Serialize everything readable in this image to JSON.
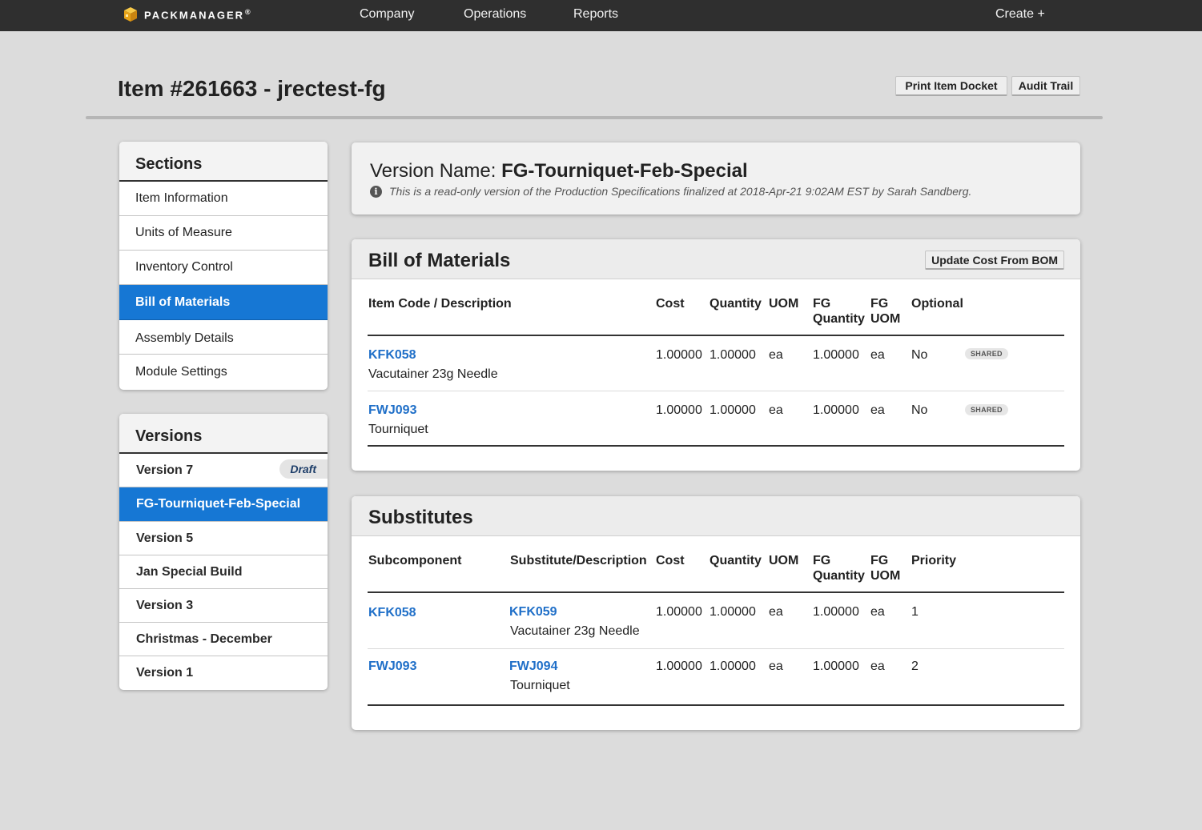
{
  "navbar": {
    "brand": "PACKMANAGER",
    "brand_mark": "®",
    "links": [
      "Company",
      "Operations",
      "Reports"
    ],
    "create": "Create +"
  },
  "page": {
    "title": "Item #261663 - jrectest-fg",
    "print_button": "Print Item Docket",
    "audit_button": "Audit Trail"
  },
  "sections": {
    "heading": "Sections",
    "items": [
      "Item Information",
      "Units of Measure",
      "Inventory Control",
      "Bill of Materials",
      "Assembly Details",
      "Module Settings"
    ],
    "active": "Bill of Materials"
  },
  "versions": {
    "heading": "Versions",
    "draft_label": "Draft",
    "items": [
      "Version 7",
      "FG-Tourniquet-Feb-Special",
      "Version 5",
      "Jan Special Build",
      "Version 3",
      "Christmas - December",
      "Version 1"
    ],
    "active": "FG-Tourniquet-Feb-Special"
  },
  "version_info": {
    "label": "Version Name:",
    "name": "FG-Tourniquet-Feb-Special",
    "note": "This is a read-only version of the Production Specifications finalized at 2018-Apr-21 9:02AM EST by Sarah Sandberg."
  },
  "bom": {
    "heading": "Bill of Materials",
    "update_button": "Update Cost From BOM",
    "columns": {
      "item": "Item Code / Description",
      "cost": "Cost",
      "quantity": "Quantity",
      "uom": "UOM",
      "fg_quantity_1": "FG",
      "fg_quantity_2": "Quantity",
      "fg_uom_1": "FG",
      "fg_uom_2": "UOM",
      "optional": "Optional"
    },
    "rows": [
      {
        "code": "KFK058",
        "description": "Vacutainer 23g Needle",
        "cost": "1.00000",
        "quantity": "1.00000",
        "uom": "ea",
        "fg_quantity": "1.00000",
        "fg_uom": "ea",
        "optional": "No",
        "badge": "SHARED"
      },
      {
        "code": "FWJ093",
        "description": "Tourniquet",
        "cost": "1.00000",
        "quantity": "1.00000",
        "uom": "ea",
        "fg_quantity": "1.00000",
        "fg_uom": "ea",
        "optional": "No",
        "badge": "SHARED"
      }
    ]
  },
  "substitutes": {
    "heading": "Substitutes",
    "columns": {
      "subcomponent": "Subcomponent",
      "substitute": "Substitute/Description",
      "cost": "Cost",
      "quantity": "Quantity",
      "uom": "UOM",
      "fg_quantity_1": "FG",
      "fg_quantity_2": "Quantity",
      "fg_uom_1": "FG",
      "fg_uom_2": "UOM",
      "priority": "Priority"
    },
    "rows": [
      {
        "subcomponent": "KFK058",
        "substitute": "KFK059",
        "description": "Vacutainer 23g Needle",
        "cost": "1.00000",
        "quantity": "1.00000",
        "uom": "ea",
        "fg_quantity": "1.00000",
        "fg_uom": "ea",
        "priority": "1"
      },
      {
        "subcomponent": "FWJ093",
        "substitute": "FWJ094",
        "description": "Tourniquet",
        "cost": "1.00000",
        "quantity": "1.00000",
        "uom": "ea",
        "fg_quantity": "1.00000",
        "fg_uom": "ea",
        "priority": "2"
      }
    ]
  },
  "colors": {
    "navbar": "#2f2f2f",
    "accent": "#1677d4",
    "link": "#1f6fc8",
    "background": "#dcdcdc"
  },
  "icons": {
    "brand": "box-icon",
    "info": "info-icon"
  }
}
